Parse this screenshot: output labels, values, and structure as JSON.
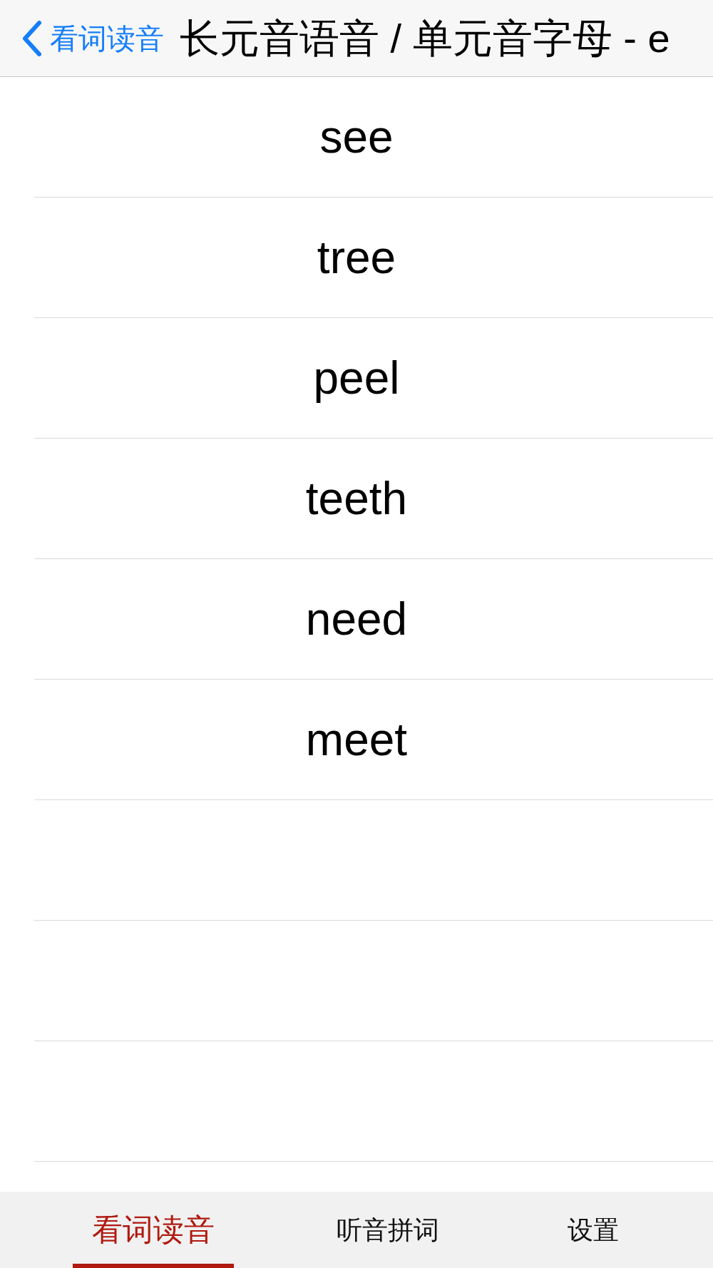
{
  "nav_bar": {
    "back_label": "看词读音",
    "title": "长元音语音 / 单元音字母 - e"
  },
  "words": [
    {
      "text": "see"
    },
    {
      "text": "tree"
    },
    {
      "text": "peel"
    },
    {
      "text": "teeth"
    },
    {
      "text": "need"
    },
    {
      "text": "meet"
    }
  ],
  "tab_bar": {
    "tabs": [
      {
        "label": "看词读音",
        "selected": true
      },
      {
        "label": "听音拼词",
        "selected": false
      },
      {
        "label": "设置",
        "selected": false
      }
    ]
  }
}
